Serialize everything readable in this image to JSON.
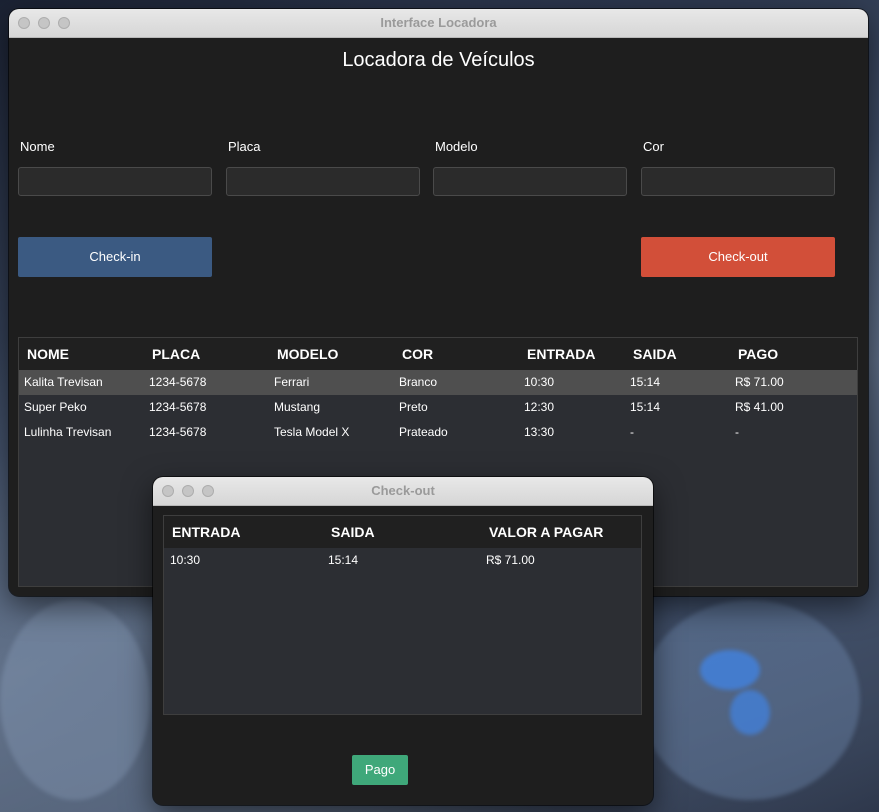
{
  "main_window": {
    "window_title": "Interface Locadora",
    "app_title": "Locadora de Veículos",
    "fields": [
      {
        "label": "Nome",
        "value": ""
      },
      {
        "label": "Placa",
        "value": ""
      },
      {
        "label": "Modelo",
        "value": ""
      },
      {
        "label": "Cor",
        "value": ""
      }
    ],
    "checkin_label": "Check-in",
    "checkout_label": "Check-out",
    "table": {
      "columns": [
        "NOME",
        "PLACA",
        "MODELO",
        "COR",
        "ENTRADA",
        "SAIDA",
        "PAGO"
      ],
      "rows": [
        [
          "Kalita Trevisan",
          "1234-5678",
          "Ferrari",
          "Branco",
          "10:30",
          "15:14",
          "R$ 71.00"
        ],
        [
          "Super Peko",
          "1234-5678",
          "Mustang",
          "Preto",
          "12:30",
          "15:14",
          "R$ 41.00"
        ],
        [
          "Lulinha Trevisan",
          "1234-5678",
          "Tesla Model X",
          "Prateado",
          "13:30",
          "-",
          "-"
        ]
      ]
    }
  },
  "dialog": {
    "window_title": "Check-out",
    "columns": [
      "ENTRADA",
      "SAIDA",
      "VALOR A PAGAR"
    ],
    "rows": [
      [
        "10:30",
        "15:14",
        "R$ 71.00"
      ]
    ],
    "pay_label": "Pago"
  },
  "colors": {
    "checkin": "#3b5a82",
    "checkout": "#d24f39",
    "pago": "#3fa87a",
    "window_bg": "#1e1e1e",
    "table_bg": "#2c2e33",
    "selected_row": "#4f4f4f"
  }
}
